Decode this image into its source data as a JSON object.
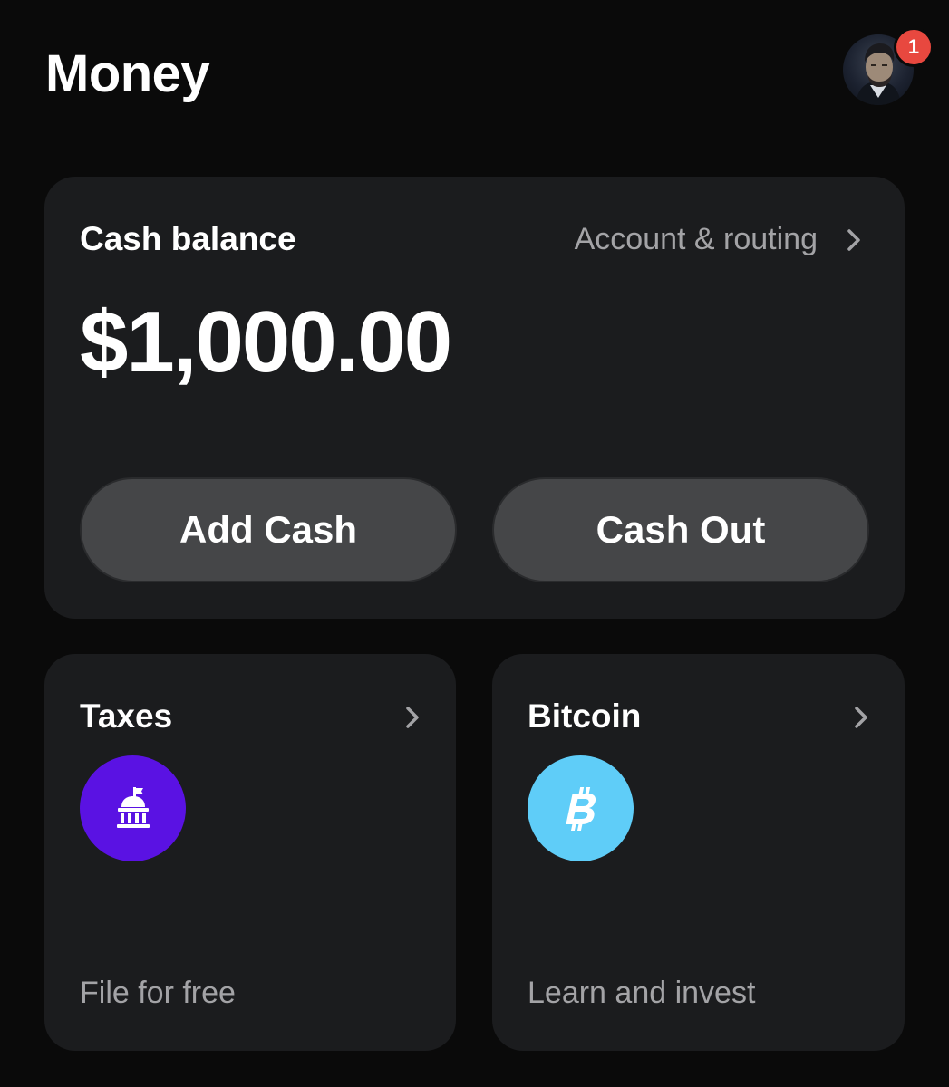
{
  "header": {
    "title": "Money",
    "notification_count": "1"
  },
  "balance_card": {
    "heading": "Cash balance",
    "account_link": "Account & routing",
    "amount": "$1,000.00",
    "add_cash_label": "Add Cash",
    "cash_out_label": "Cash Out"
  },
  "tiles": [
    {
      "title": "Taxes",
      "caption": "File for free",
      "icon": "government-building-icon",
      "icon_color": "#5a12e3"
    },
    {
      "title": "Bitcoin",
      "caption": "Learn and invest",
      "icon": "bitcoin-icon",
      "icon_color": "#5fcdf8"
    }
  ],
  "colors": {
    "background": "#0a0a0a",
    "card": "#1b1c1e",
    "button": "#454648",
    "muted_text": "#a3a3a6",
    "badge": "#e8483f"
  }
}
